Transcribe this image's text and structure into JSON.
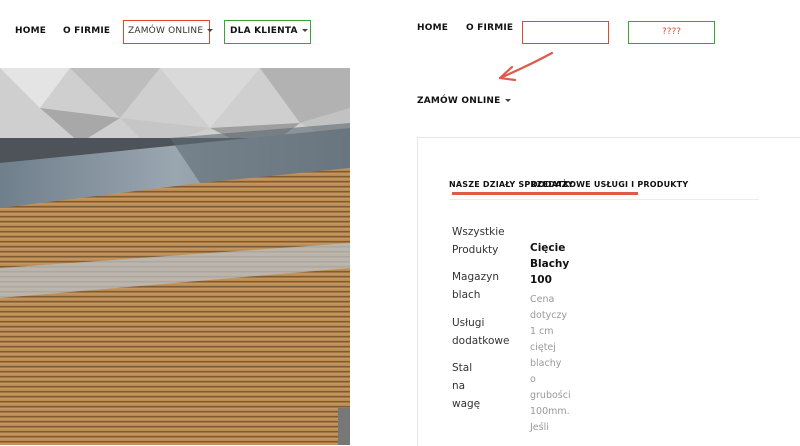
{
  "left_nav": {
    "home": "HOME",
    "about": "O FIRMIE",
    "order_online": "ZAMÓW ONLINE",
    "for_client": "DLA KLIENTA"
  },
  "right_nav": {
    "home": "HOME",
    "about": "O FIRMIE",
    "green_box_text": "????",
    "order_online": "ZAMÓW ONLINE"
  },
  "card": {
    "tab_1": "NASZE DZIAŁY SPRZEDAŻY",
    "tab_2": "DODATKOWE USŁUGI I PRODUKTY",
    "categories": [
      {
        "line1": "Wszystkie",
        "line2": "Produkty"
      },
      {
        "line1": "Magazyn",
        "line2": "blach"
      },
      {
        "line1": "Usługi",
        "line2": "dodatkowe"
      },
      {
        "line1": "Stal",
        "line2": "na",
        "line3": "wagę"
      }
    ],
    "product": {
      "title_lines": [
        "Cięcie",
        "Blachy",
        "100"
      ],
      "desc_lines": [
        "Cena",
        "dotyczy",
        "1 cm",
        "ciętej",
        "blachy",
        "o",
        "grubości",
        "100mm.",
        "Jeśli"
      ]
    }
  },
  "colors": {
    "annotation_red": "#e8462c",
    "annotation_green": "#3aa43a",
    "underline": "#e05a4a"
  },
  "icons": [
    "caret-down-icon",
    "arrow-annotation-icon"
  ]
}
